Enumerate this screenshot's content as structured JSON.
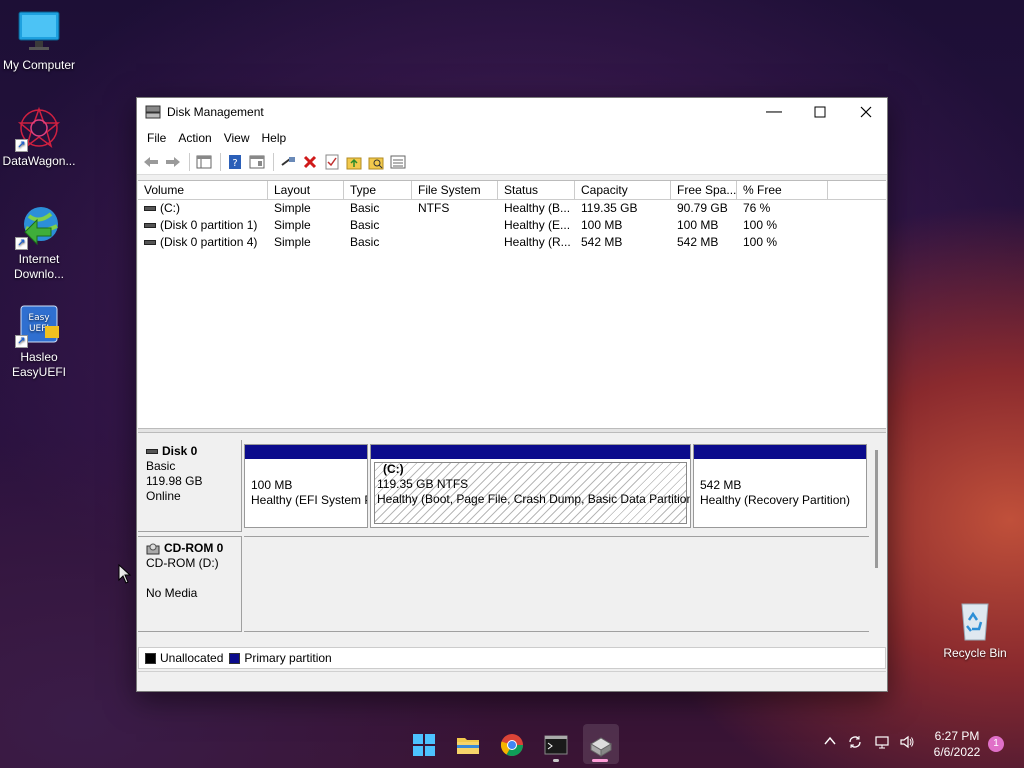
{
  "desktop": {
    "icons": [
      {
        "label": "My Computer"
      },
      {
        "label": "DataWagon..."
      },
      {
        "label": "Internet Downlo..."
      },
      {
        "label": "Hasleo EasyUEFI"
      },
      {
        "label": "Recycle Bin"
      }
    ]
  },
  "window": {
    "title": "Disk Management",
    "menu": [
      "File",
      "Action",
      "View",
      "Help"
    ],
    "columns": [
      "Volume",
      "Layout",
      "Type",
      "File System",
      "Status",
      "Capacity",
      "Free Spa...",
      "% Free"
    ],
    "rows": [
      {
        "volume": "(C:)",
        "layout": "Simple",
        "type": "Basic",
        "fs": "NTFS",
        "status": "Healthy (B...",
        "capacity": "119.35 GB",
        "free": "90.79 GB",
        "pct": "76 %"
      },
      {
        "volume": "(Disk 0 partition 1)",
        "layout": "Simple",
        "type": "Basic",
        "fs": "",
        "status": "Healthy (E...",
        "capacity": "100 MB",
        "free": "100 MB",
        "pct": "100 %"
      },
      {
        "volume": "(Disk 0 partition 4)",
        "layout": "Simple",
        "type": "Basic",
        "fs": "",
        "status": "Healthy (R...",
        "capacity": "542 MB",
        "free": "542 MB",
        "pct": "100 %"
      }
    ],
    "disk0": {
      "name": "Disk 0",
      "type": "Basic",
      "size": "119.98 GB",
      "state": "Online",
      "partitions": [
        {
          "name": "",
          "line1": "100 MB",
          "line2": "Healthy (EFI System P"
        },
        {
          "name": "(C:)",
          "line1": "119.35 GB NTFS",
          "line2": "Healthy (Boot, Page File, Crash Dump, Basic Data Partition"
        },
        {
          "name": "",
          "line1": "542 MB",
          "line2": "Healthy (Recovery Partition)"
        }
      ]
    },
    "cdrom": {
      "name": "CD-ROM 0",
      "drive": "CD-ROM (D:)",
      "media": "No Media"
    },
    "legend": {
      "unallocated": "Unallocated",
      "primary": "Primary partition"
    },
    "colors": {
      "primary": "#0b0b8c",
      "unallocated": "#000000"
    }
  },
  "taskbar": {
    "clock_time": "6:27 PM",
    "clock_date": "6/6/2022",
    "notification_count": "1"
  }
}
